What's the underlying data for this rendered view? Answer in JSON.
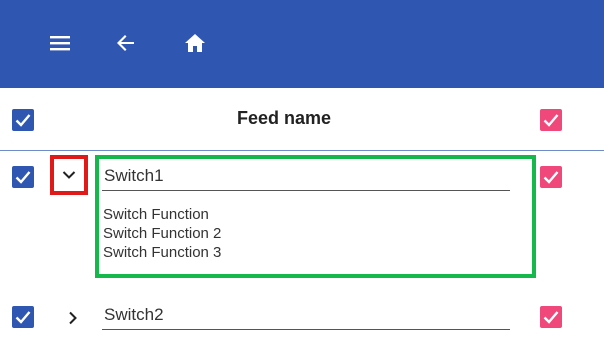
{
  "toolbar": {
    "menu_icon": "hamburger-menu-icon",
    "back_icon": "arrow-back-icon",
    "home_icon": "home-icon",
    "background_color": "#2f57b2"
  },
  "table": {
    "header": {
      "title": "Feed name",
      "select_all_checked": true,
      "right_checked": true
    },
    "rows": [
      {
        "name": "Switch1",
        "expanded": true,
        "left_checked": true,
        "right_checked": true,
        "functions": [
          "Switch Function",
          "Switch Function 2",
          "Switch Function 3"
        ]
      },
      {
        "name": "Switch2",
        "expanded": false,
        "left_checked": true,
        "right_checked": true,
        "functions": []
      }
    ]
  },
  "colors": {
    "blue_checkbox": "#2f57b2",
    "pink_checkbox": "#f0487a",
    "highlight_red": "#e01919",
    "highlight_green": "#15b84a"
  }
}
